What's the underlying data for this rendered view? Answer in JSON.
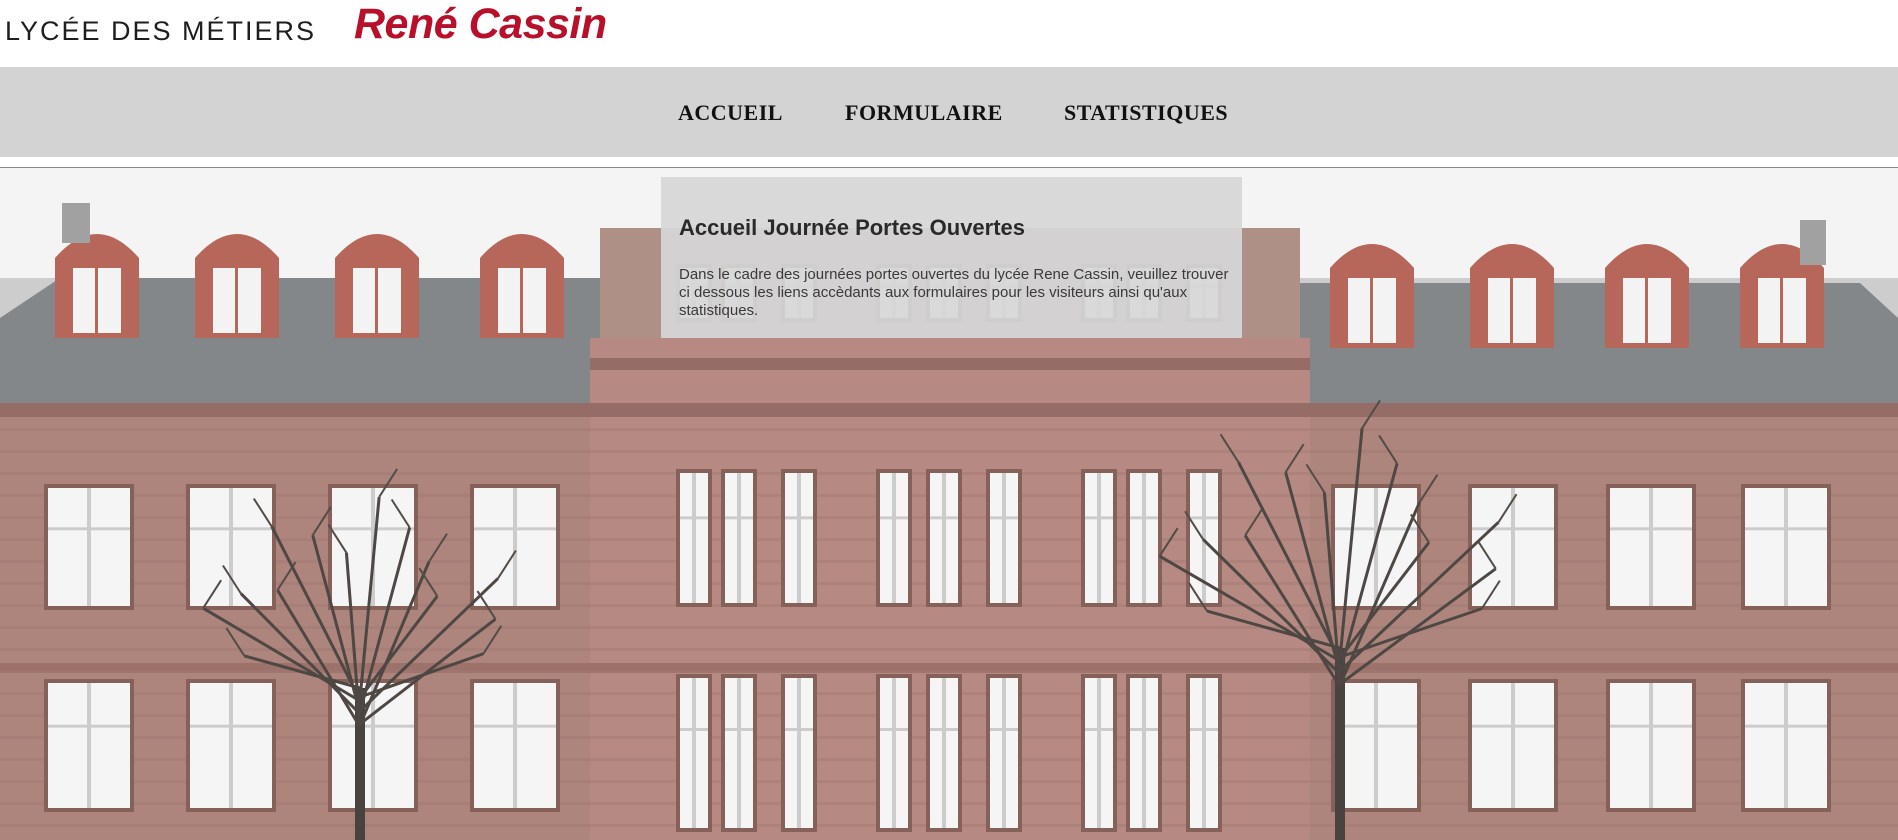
{
  "header": {
    "logo_prefix": "LYCÉE DES MÉTIERS",
    "logo_name": "René Cassin"
  },
  "nav": {
    "items": [
      {
        "label": "ACCUEIL"
      },
      {
        "label": "FORMULAIRE"
      },
      {
        "label": "STATISTIQUES"
      }
    ]
  },
  "main": {
    "title": "Accueil Journée Portes Ouvertes",
    "text": "Dans le cadre des journées portes ouvertes du lycée Rene Cassin, veuillez trouver ci dessous les liens accèdants aux formulaires pour les visiteurs ainsi qu'aux statistiques."
  },
  "colors": {
    "brand_red": "#b8102a",
    "nav_background": "#d3d3d3",
    "panel_background": "#d6d6d6"
  }
}
